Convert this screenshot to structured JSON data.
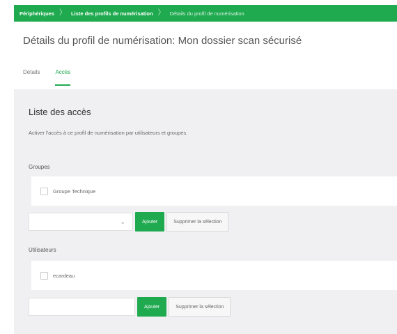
{
  "breadcrumb": {
    "items": [
      "Périphériques",
      "Liste des profils de numérisation",
      "Détails du profil de numérisation"
    ],
    "separator": "〉"
  },
  "page": {
    "title": "Détails du profil de numérisation: Mon dossier scan sécurisé"
  },
  "tabs": [
    {
      "label": "Détails",
      "active": false
    },
    {
      "label": "Accès",
      "active": true
    }
  ],
  "access": {
    "title": "Liste des accès",
    "description": "Activer l'accès à ce profil de numérisation par utilisateurs et groupes.",
    "groups": {
      "label": "Groupes",
      "items": [
        "Groupe Technique"
      ],
      "select_value": "",
      "add_label": "Ajouter",
      "clear_label": "Supprimer la sélection"
    },
    "users": {
      "label": "Utilisateurs",
      "items": [
        "ecardeau"
      ],
      "input_value": "",
      "add_label": "Ajouter",
      "clear_label": "Supprimer la sélection"
    }
  },
  "colors": {
    "accent": "#1faa4f",
    "panel_bg": "#f0f0f2"
  },
  "icons": {
    "select_arrow": "chevron-down-icon"
  }
}
